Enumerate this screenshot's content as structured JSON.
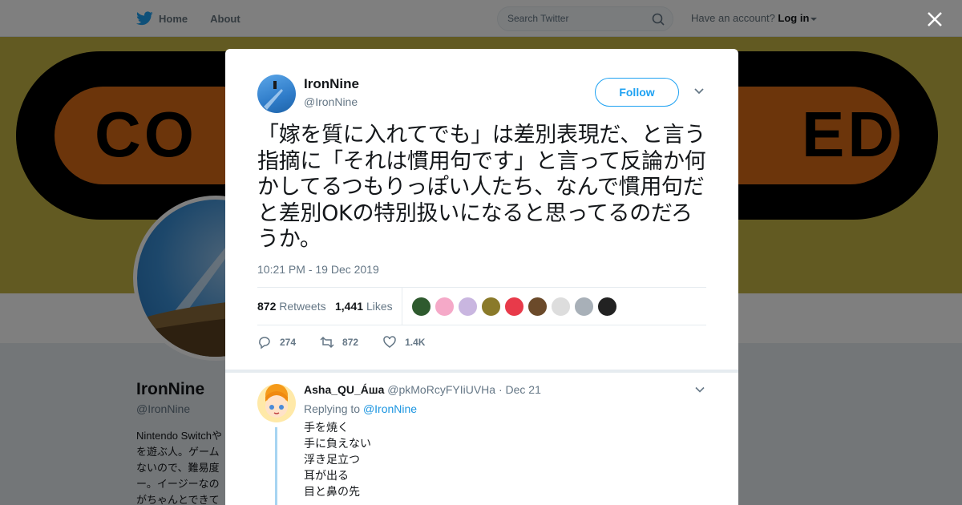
{
  "nav": {
    "home_label": "Home",
    "about_label": "About",
    "search_placeholder": "Search Twitter",
    "have_account": "Have an account?",
    "login_label": "Log in"
  },
  "banner": {
    "letters_left": "CO",
    "letters_right": "ED"
  },
  "profile": {
    "name": "IronNine",
    "handle": "@IronNine",
    "bio": "Nintendo Switchや\nを遊ぶ人。ゲーム\nないので、難易度\nー。イージーなの\nがちゃんとできて"
  },
  "tweet": {
    "author_name": "IronNine",
    "author_handle": "@IronNine",
    "follow_label": "Follow",
    "text": "「嫁を質に入れてでも」は差別表現だ、と言う指摘に「それは慣用句です」と言って反論か何かしてるつもりっぽい人たち、なんで慣用句だと差別OKの特別扱いになると思ってるのだろうか。",
    "timestamp": "10:21 PM - 19 Dec 2019",
    "retweets_count": "872",
    "retweets_label": "Retweets",
    "likes_count": "1,441",
    "likes_label": "Likes",
    "liker_colors": [
      "#2e5a2e",
      "#f5a9c8",
      "#c9b6e0",
      "#8a7a2a",
      "#e83a4a",
      "#6b4a2a",
      "#dddddd",
      "#a8b0b8",
      "#222222"
    ],
    "actions": {
      "reply_count": "274",
      "retweet_count": "872",
      "like_count": "1.4K"
    }
  },
  "reply": {
    "name": "Asha_QU_Áша",
    "handle": "@pkMoRcyFYIiUVHa",
    "date": "Dec 21",
    "replying_to_label": "Replying to",
    "replying_to_handle": "@IronNine",
    "text": "手を焼く\n手に負えない\n浮き足立つ\n耳が出る\n目と鼻の先"
  }
}
